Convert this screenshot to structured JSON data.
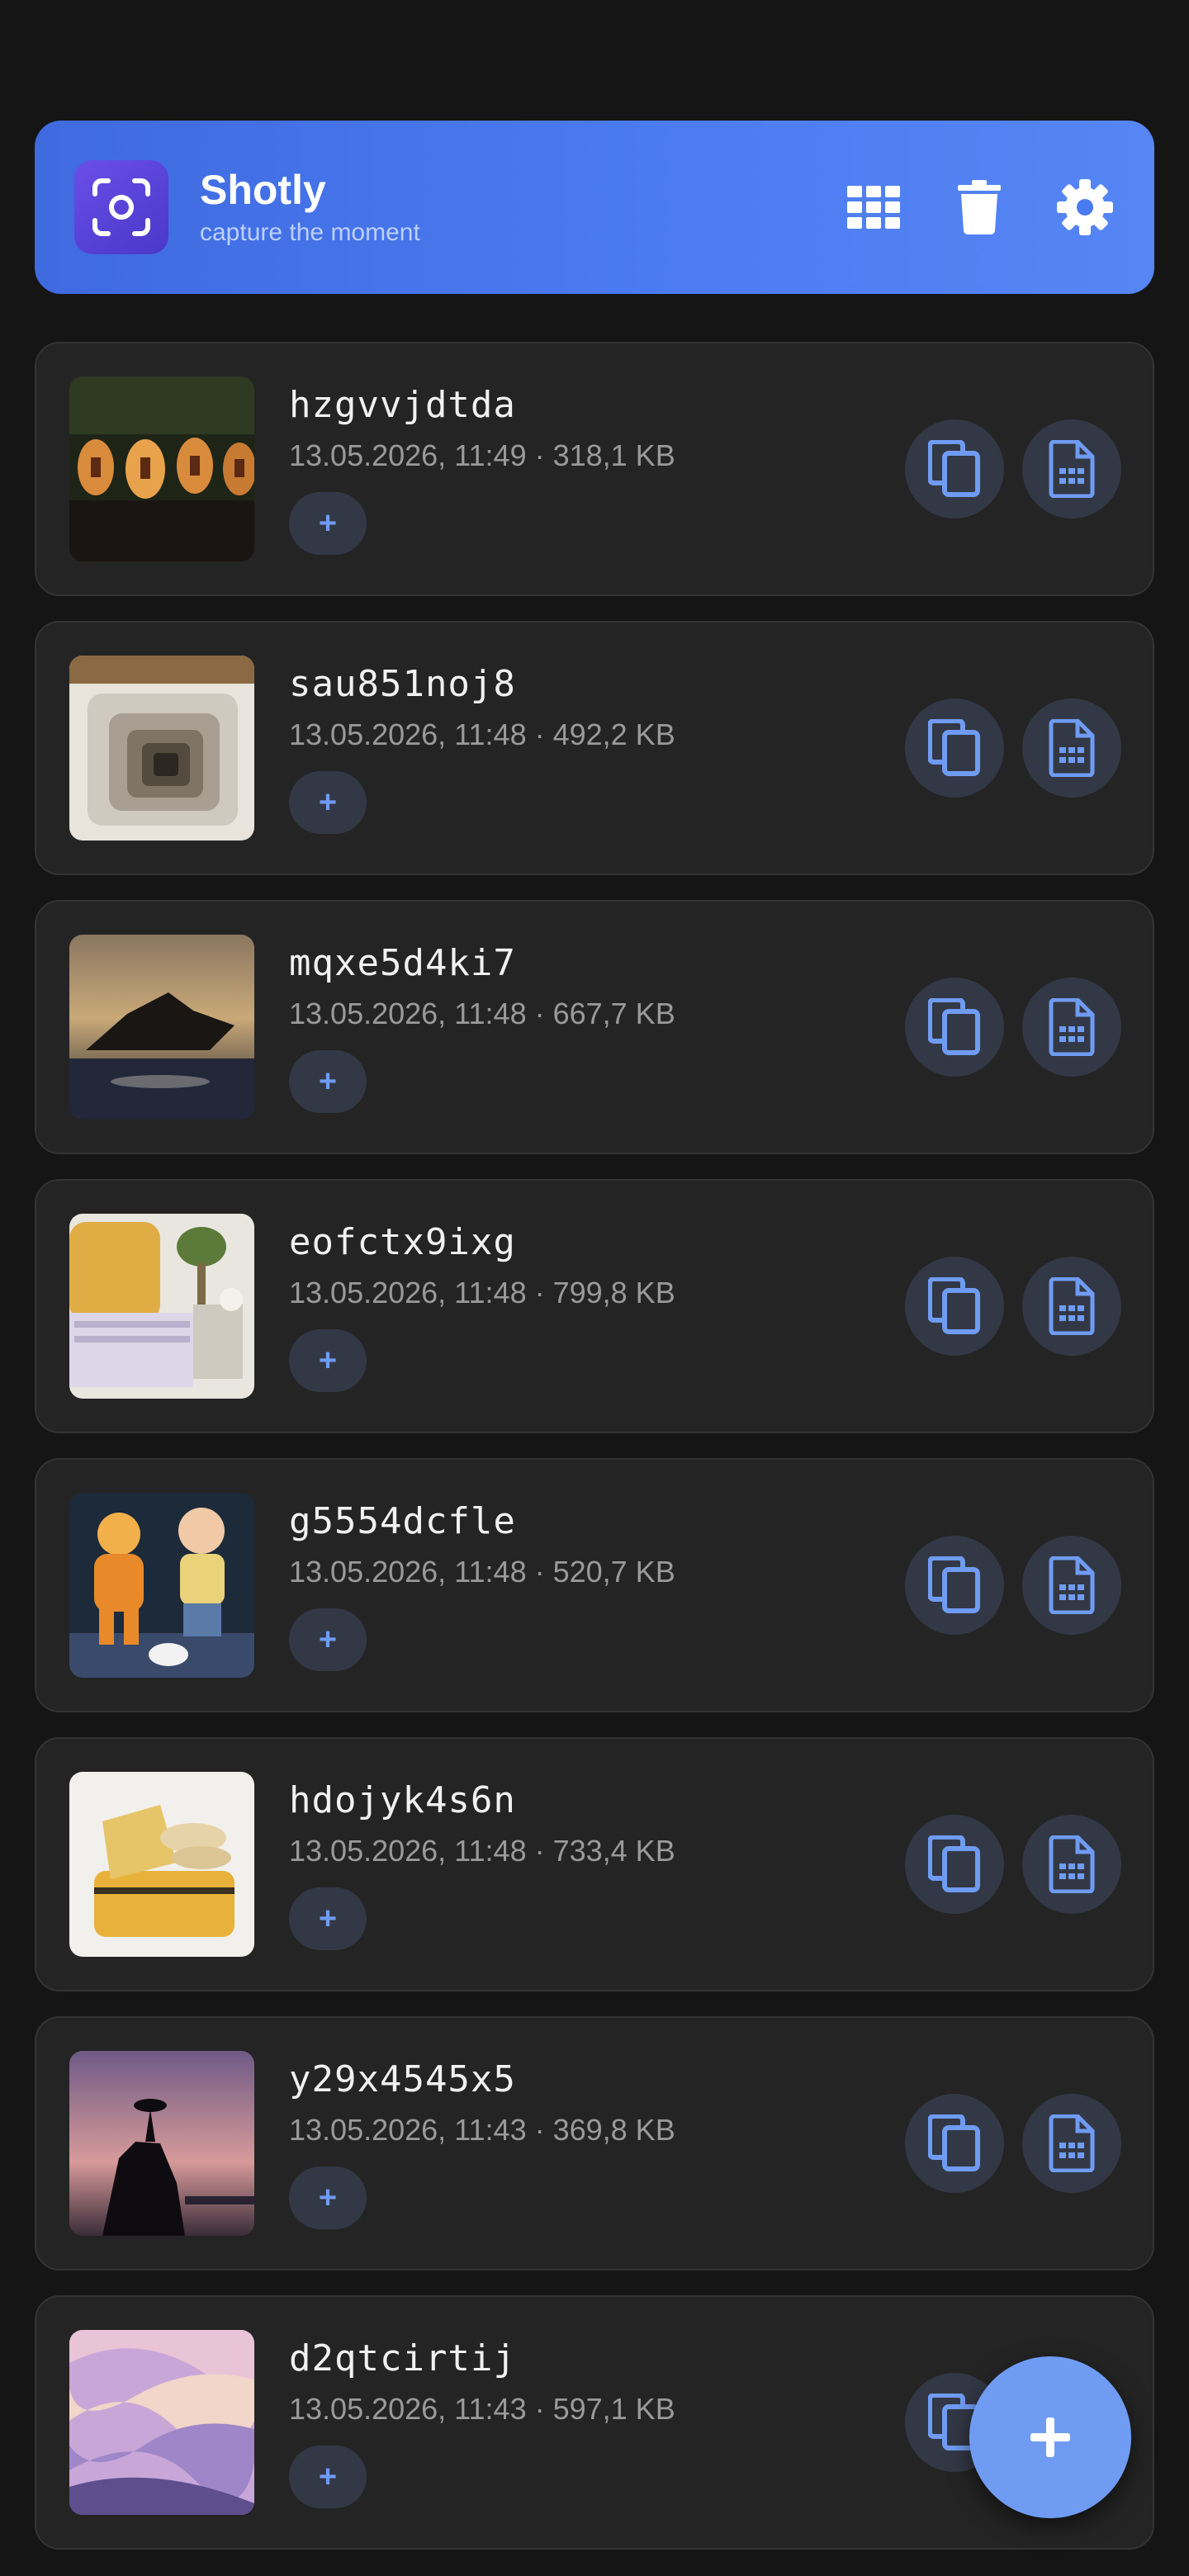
{
  "app": {
    "title": "Shotly",
    "subtitle": "capture the moment",
    "accent": "#4b7bf0",
    "icon": "camera-frame-icon"
  },
  "toolbar": {
    "actions": [
      {
        "icon": "grid-view-icon"
      },
      {
        "icon": "trash-icon"
      },
      {
        "icon": "settings-gear-icon"
      }
    ]
  },
  "items": [
    {
      "name": "hzgvvjdtda",
      "meta": "13.05.2026, 11:49 · 318,1 KB",
      "tag_label": "+",
      "thumb": "lanterns-night"
    },
    {
      "name": "sau851noj8",
      "meta": "13.05.2026, 11:48 · 492,2 KB",
      "tag_label": "+",
      "thumb": "spiral-stairs"
    },
    {
      "name": "mqxe5d4ki7",
      "meta": "13.05.2026, 11:48 · 667,7 KB",
      "tag_label": "+",
      "thumb": "island-sunset"
    },
    {
      "name": "eofctx9ixg",
      "meta": "13.05.2026, 11:48 · 799,8 KB",
      "tag_label": "+",
      "thumb": "bedroom-plant"
    },
    {
      "name": "g5554dcfle",
      "meta": "13.05.2026, 11:48 · 520,7 KB",
      "tag_label": "+",
      "thumb": "toy-figures"
    },
    {
      "name": "hdojyk4s6n",
      "meta": "13.05.2026, 11:48 · 733,4 KB",
      "tag_label": "+",
      "thumb": "yellow-luggage"
    },
    {
      "name": "y29x4545x5",
      "meta": "13.05.2026, 11:43 · 369,8 KB",
      "tag_label": "+",
      "thumb": "rock-silhouette"
    },
    {
      "name": "d2qtcirtij",
      "meta": "13.05.2026, 11:43 · 597,1 KB",
      "tag_label": "+",
      "thumb": "pastel-waves"
    }
  ],
  "item_actions": {
    "copy_icon": "copy-icon",
    "file_icon": "document-icon",
    "icon_color": "#6f9cf2"
  },
  "fab": {
    "label": "+",
    "color": "#6f9cf2"
  }
}
